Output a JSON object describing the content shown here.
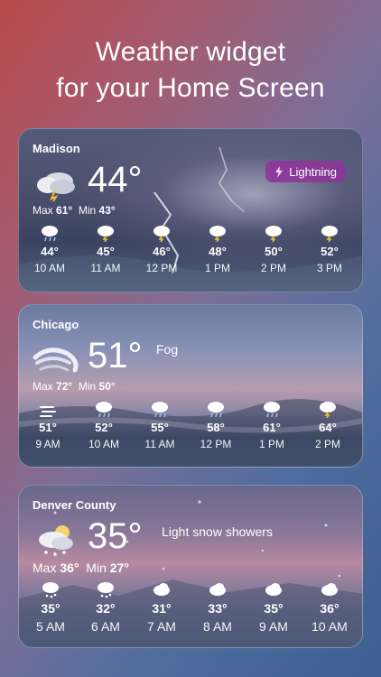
{
  "headline": {
    "line1": "Weather widget",
    "line2": "for your Home Screen"
  },
  "cards": [
    {
      "city": "Madison",
      "temp": "44°",
      "condition_icon": "thunderstorm-cloud-icon",
      "max_label": "Max",
      "max_value": "61°",
      "min_label": "Min",
      "min_value": "43°",
      "alert": {
        "icon": "lightning-bolt-icon",
        "label": "Lightning"
      },
      "hours": [
        {
          "temp": "44°",
          "time": "10 AM",
          "icon": "cloud-rain-icon"
        },
        {
          "temp": "45°",
          "time": "11 AM",
          "icon": "cloud-lightning-icon"
        },
        {
          "temp": "46°",
          "time": "12 PM",
          "icon": "cloud-lightning-icon"
        },
        {
          "temp": "48°",
          "time": "1 PM",
          "icon": "cloud-lightning-icon"
        },
        {
          "temp": "50°",
          "time": "2 PM",
          "icon": "cloud-lightning-icon"
        },
        {
          "temp": "52°",
          "time": "3 PM",
          "icon": "cloud-lightning-icon"
        }
      ]
    },
    {
      "city": "Chicago",
      "temp": "51°",
      "condition": "Fog",
      "condition_icon": "fog-icon",
      "max_label": "Max",
      "max_value": "72°",
      "min_label": "Min",
      "min_value": "50°",
      "hours": [
        {
          "temp": "51°",
          "time": "9 AM",
          "icon": "fog-lines-icon"
        },
        {
          "temp": "52°",
          "time": "10 AM",
          "icon": "cloud-rain-icon"
        },
        {
          "temp": "55°",
          "time": "11 AM",
          "icon": "cloud-rain-icon"
        },
        {
          "temp": "58°",
          "time": "12 PM",
          "icon": "cloud-rain-icon"
        },
        {
          "temp": "61°",
          "time": "1 PM",
          "icon": "cloud-rain-icon"
        },
        {
          "temp": "64°",
          "time": "2 PM",
          "icon": "cloud-lightning-icon"
        }
      ]
    },
    {
      "city": "Denver County",
      "temp": "35°",
      "condition": "Light snow showers",
      "condition_icon": "snow-cloud-icon",
      "max_label": "Max",
      "max_value": "36°",
      "min_label": "Min",
      "min_value": "27°",
      "hours": [
        {
          "temp": "35°",
          "time": "5 AM",
          "icon": "cloud-snow-icon"
        },
        {
          "temp": "32°",
          "time": "6 AM",
          "icon": "cloud-snow-icon"
        },
        {
          "temp": "31°",
          "time": "7 AM",
          "icon": "cloud-icon"
        },
        {
          "temp": "33°",
          "time": "8 AM",
          "icon": "cloud-icon"
        },
        {
          "temp": "35°",
          "time": "9 AM",
          "icon": "cloud-icon"
        },
        {
          "temp": "36°",
          "time": "10 AM",
          "icon": "cloud-icon"
        }
      ]
    }
  ],
  "colors": {
    "alert_chip": "#8e3498",
    "lightning": "#f2c230"
  }
}
